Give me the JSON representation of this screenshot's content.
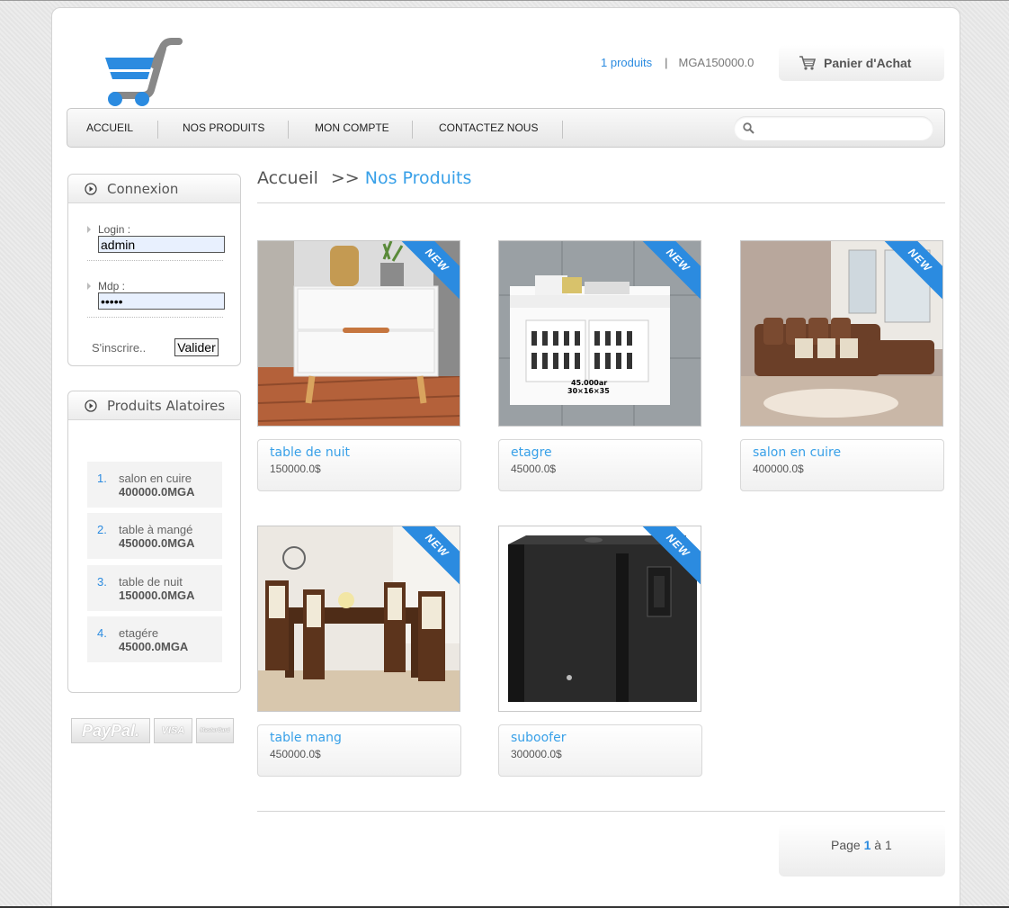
{
  "header": {
    "cart_count": "1 produits",
    "separator": "|",
    "cart_total": "MGA150000.0",
    "cart_button_label": "Panier d'Achat"
  },
  "nav": {
    "items": [
      "ACCUEIL",
      "NOS PRODUITS",
      "MON COMPTE",
      "CONTACTEZ NOUS"
    ],
    "search_value": ""
  },
  "login": {
    "title": "Connexion",
    "login_label": "Login :",
    "login_value": "admin",
    "password_label": "Mdp :",
    "password_value": "aaaaa",
    "signup_link": "S'inscrire..",
    "submit_label": "Valider"
  },
  "random": {
    "title": "Produits Alatoires",
    "items": [
      {
        "num": "1.",
        "name": "salon en cuire",
        "price": "400000.0MGA"
      },
      {
        "num": "2.",
        "name": "table à mangé",
        "price": "450000.0MGA"
      },
      {
        "num": "3.",
        "name": "table de nuit",
        "price": "150000.0MGA"
      },
      {
        "num": "4.",
        "name": "etagére",
        "price": "45000.0MGA"
      }
    ]
  },
  "payments": [
    "PayPal.",
    "VISA",
    "MasterCard"
  ],
  "breadcrumb": {
    "home": "Accueil",
    "arrows": ">>",
    "current": "Nos Produits"
  },
  "products": [
    {
      "name": "table de nuit",
      "price": "150000.0$",
      "badge": "NEW",
      "image": "nightstand"
    },
    {
      "name": "etagre",
      "price": "45000.0$",
      "badge": "NEW",
      "image": "wall-shelf",
      "image_caption": "45.000ar\n30×16×35"
    },
    {
      "name": "salon en cuire",
      "price": "400000.0$",
      "badge": "NEW",
      "image": "sofa"
    },
    {
      "name": "table  mang",
      "price": "450000.0$",
      "badge": "NEW",
      "image": "dining-table"
    },
    {
      "name": "suboofer",
      "price": "300000.0$",
      "badge": "NEW",
      "image": "subwoofer"
    }
  ],
  "pager": {
    "prefix": "Page",
    "current": "1",
    "middle": "à",
    "total": "1"
  },
  "colors": {
    "accent": "#2b8be0",
    "heading_blue": "#38a0e8",
    "text": "#555555"
  }
}
